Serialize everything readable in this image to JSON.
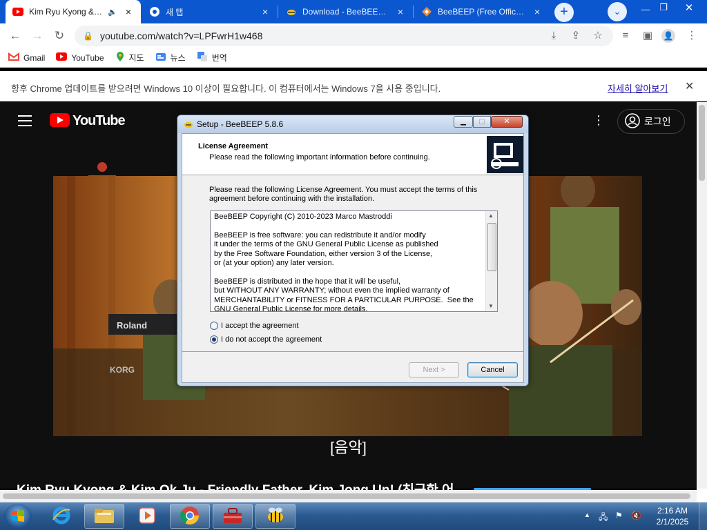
{
  "browser": {
    "tabs": [
      {
        "title": "Kim Ryu Kyong & Kim Ok Ju",
        "close": "×"
      },
      {
        "title": "새 탭",
        "close": "×"
      },
      {
        "title": "Download - BeeBEEP - Free",
        "close": "×"
      },
      {
        "title": "BeeBEEP (Free Office Mess",
        "close": "×"
      }
    ],
    "new_tab": "+",
    "url": "youtube.com/watch?v=LPFwrH1w468",
    "bookmarks": [
      {
        "label": "Gmail",
        "icon": "gmail-icon"
      },
      {
        "label": "YouTube",
        "icon": "youtube-icon"
      },
      {
        "label": "지도",
        "icon": "maps-icon"
      },
      {
        "label": "뉴스",
        "icon": "news-icon"
      },
      {
        "label": "번역",
        "icon": "translate-icon"
      }
    ],
    "infobar": {
      "message": "향후 Chrome 업데이트를 받으려면 Windows 10 이상이 필요합니다. 이 컴퓨터에서는 Windows 7을 사용 중입니다.",
      "link": "자세히 알아보기",
      "close": "✕"
    }
  },
  "youtube": {
    "logo_text": "YouTube",
    "signin": "로그인",
    "caption": "[음악]",
    "video_title": "Kim Ryu Kyong & Kim Ok Ju - Friendly Father, Kim Jong Un! (친근한 어",
    "video_overlay_text": [
      "Roland",
      "KORG"
    ]
  },
  "dialog": {
    "title": "Setup - BeeBEEP 5.8.6",
    "heading": "License Agreement",
    "subheading": "Please read the following important information before continuing.",
    "instruction_line1": "Please read the following License Agreement. You must accept the terms of this",
    "instruction_line2": "agreement before continuing with the installation.",
    "license_lines": [
      "BeeBEEP Copyright (C) 2010-2023 Marco Mastroddi",
      "",
      "BeeBEEP is free software: you can redistribute it and/or modify",
      "it under the terms of the GNU General Public License as published",
      "by the Free Software Foundation, either version 3 of the License,",
      "or (at your option) any later version.",
      "",
      "BeeBEEP is distributed in the hope that it will be useful,",
      "but WITHOUT ANY WARRANTY; without even the implied warranty of",
      "MERCHANTABILITY or FITNESS FOR A PARTICULAR PURPOSE.  See the",
      "GNU General Public License for more details."
    ],
    "accept_label": "I accept the agreement",
    "decline_label": "I do not accept the agreement",
    "selected_option": "decline",
    "next_button": "Next >",
    "cancel_button": "Cancel"
  },
  "taskbar": {
    "time": "2:16 AM",
    "date": "2/1/2025"
  },
  "colors": {
    "chrome_blue": "#0b57d0",
    "youtube_red": "#ff0000",
    "taskbar": "#2b5b91"
  }
}
